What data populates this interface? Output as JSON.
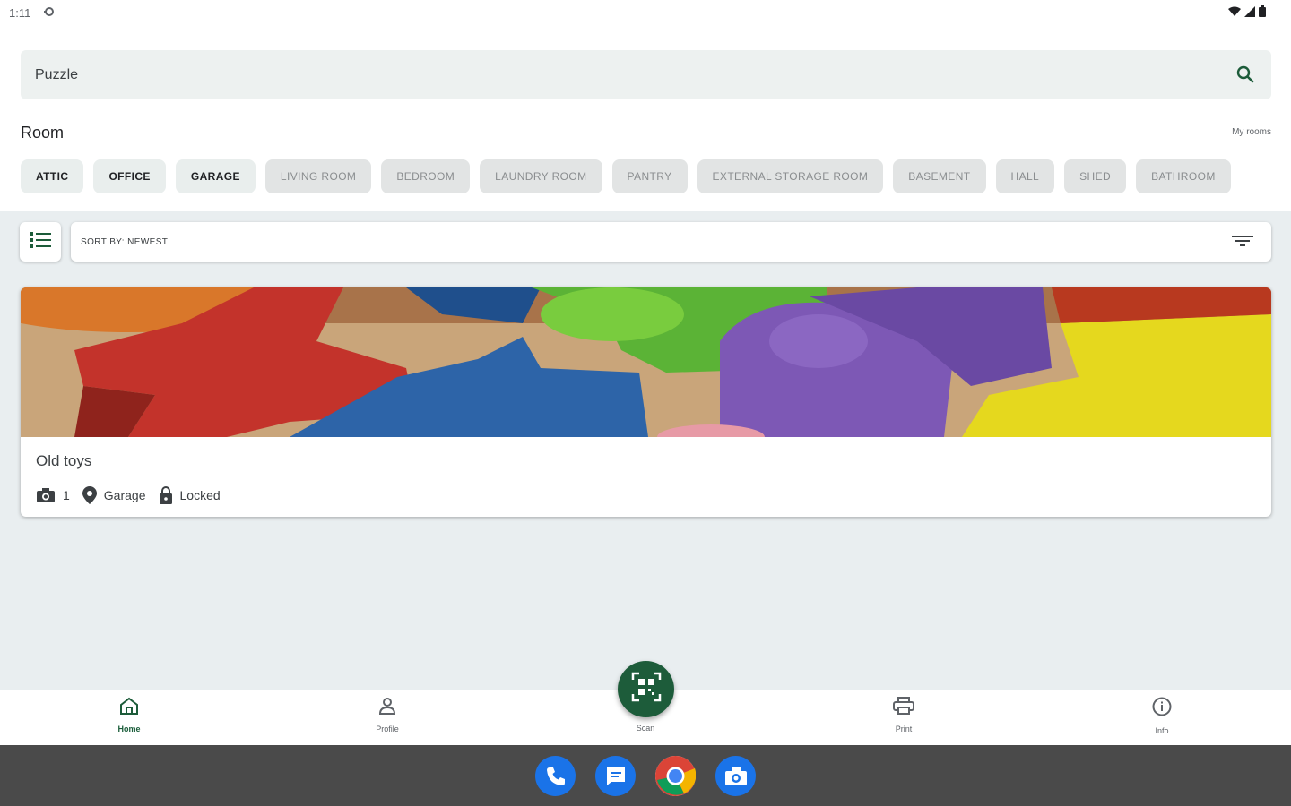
{
  "status_bar": {
    "time": "1:11"
  },
  "search": {
    "value": "Puzzle",
    "placeholder": ""
  },
  "room_section": {
    "title": "Room",
    "my_rooms_link": "My rooms",
    "chips": [
      {
        "label": "ATTIC",
        "state": "active"
      },
      {
        "label": "OFFICE",
        "state": "active"
      },
      {
        "label": "GARAGE",
        "state": "active"
      },
      {
        "label": "LIVING ROOM",
        "state": "dim"
      },
      {
        "label": "BEDROOM",
        "state": "dim"
      },
      {
        "label": "LAUNDRY ROOM",
        "state": "dim"
      },
      {
        "label": "PANTRY",
        "state": "dim"
      },
      {
        "label": "EXTERNAL STORAGE ROOM",
        "state": "dim"
      },
      {
        "label": "BASEMENT",
        "state": "dim"
      },
      {
        "label": "HALL",
        "state": "dim"
      },
      {
        "label": "SHED",
        "state": "dim"
      },
      {
        "label": "BATHROOM",
        "state": "dim"
      }
    ]
  },
  "sort": {
    "label": "SORT BY:  NEWEST"
  },
  "card": {
    "title": "Old toys",
    "photo_count": "1",
    "location": "Garage",
    "lock_status": "Locked",
    "image_icon": "toy-letters-photo"
  },
  "bottom_nav": {
    "items": [
      {
        "label": "Home",
        "icon": "home-icon"
      },
      {
        "label": "Profile",
        "icon": "profile-icon"
      },
      {
        "label": "Scan",
        "icon": "qr-scan-icon"
      },
      {
        "label": "Print",
        "icon": "printer-icon"
      },
      {
        "label": "Info",
        "icon": "info-icon"
      }
    ]
  },
  "dock": [
    "phone-app",
    "messages-app",
    "chrome-app",
    "camera-app"
  ],
  "colors": {
    "accent": "#1d5c3a",
    "chip_bg": "#e9eeed",
    "content_bg": "#e9eef0",
    "taskbar": "#4a4a4a"
  }
}
